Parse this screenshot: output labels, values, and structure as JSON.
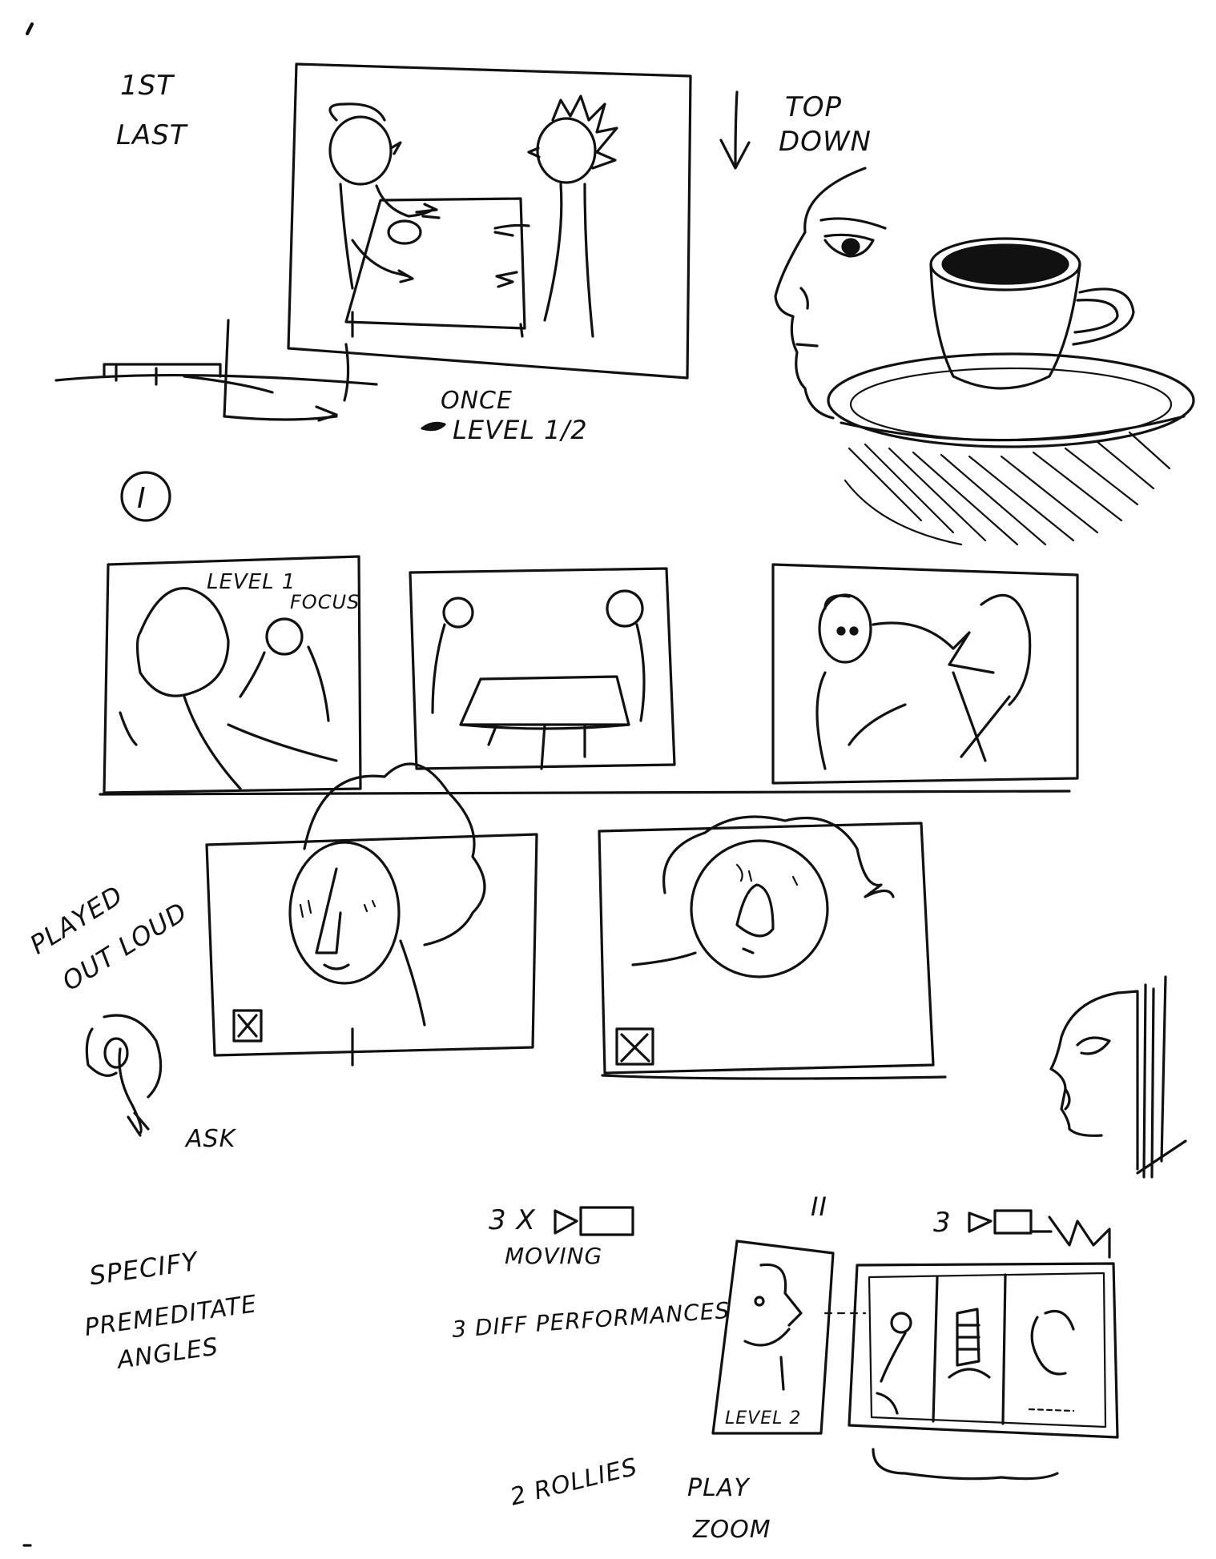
{
  "notes": {
    "first_last_1": "1ST",
    "first_last_2": "LAST",
    "top_down_1": "TOP",
    "top_down_2": "DOWN",
    "once_1": "ONCE",
    "once_2": "LEVEL 1/2",
    "section_one": "I",
    "level_focus_1": "LEVEL 1",
    "level_focus_2": "FOCUS",
    "played_1": "PLAYED",
    "played_2": "OUT LOUD",
    "ask": "ASK",
    "specify_1": "SPECIFY",
    "specify_2": "PREMEDITATE",
    "specify_3": "ANGLES",
    "moving_1": "3 X",
    "moving_2": "MOVING",
    "performances": "3 DIFF PERFORMANCES",
    "section_two": "II",
    "three_count": "3",
    "level_two": "LEVEL 2",
    "rollies": "2 ROLLIES",
    "play_zoom_1": "PLAY",
    "play_zoom_2": "ZOOM"
  }
}
